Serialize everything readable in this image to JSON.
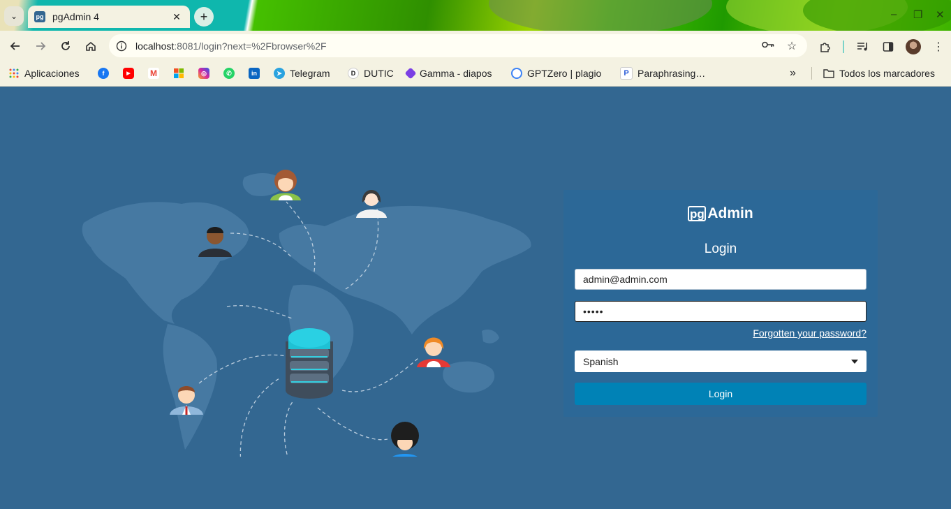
{
  "browser": {
    "tab_title": "pgAdmin 4",
    "tab_favicon_text": "pg",
    "new_tab_label": "+",
    "url_host": "localhost",
    "url_path": ":8081/login?next=%2Fbrowser%2F",
    "window_controls": [
      "–",
      "❐",
      "✕"
    ]
  },
  "bookmarks": {
    "items": [
      {
        "label": "Aplicaciones",
        "icon": "apps-grid-icon"
      },
      {
        "label": "",
        "icon": "facebook-icon",
        "color": "#1877f2"
      },
      {
        "label": "",
        "icon": "youtube-icon",
        "color": "#ff0000"
      },
      {
        "label": "",
        "icon": "gmail-icon",
        "color": "#ea4335"
      },
      {
        "label": "",
        "icon": "microsoft-icon",
        "color": "#f25022"
      },
      {
        "label": "",
        "icon": "instagram-icon",
        "color": "#d6249f"
      },
      {
        "label": "",
        "icon": "whatsapp-icon",
        "color": "#25d366"
      },
      {
        "label": "",
        "icon": "linkedin-icon",
        "color": "#0a66c2"
      },
      {
        "label": "Telegram",
        "icon": "telegram-icon",
        "color": "#2aa3df"
      },
      {
        "label": "DUTIC",
        "icon": "dutic-icon",
        "color": "#111111"
      },
      {
        "label": "Gamma - diapos",
        "icon": "gamma-icon",
        "color": "#7b3fe4"
      },
      {
        "label": "GPTZero | plagio",
        "icon": "gptzero-icon",
        "color": "#3b82f6"
      },
      {
        "label": "Paraphrasing…",
        "icon": "paraphrasing-icon",
        "color": "#2a5bd7"
      }
    ],
    "overflow": "»",
    "all_bookmarks": "Todos los marcadores"
  },
  "login": {
    "brand_pg": "pg",
    "brand_name": "Admin",
    "title": "Login",
    "email_value": "admin@admin.com",
    "password_value": "•••••",
    "forgot_link": "Forgotten your password?",
    "language_selected": "Spanish",
    "submit_label": "Login"
  },
  "colors": {
    "page_background": "#336791",
    "card_background": "#2c6897",
    "login_button": "#0082b6"
  }
}
